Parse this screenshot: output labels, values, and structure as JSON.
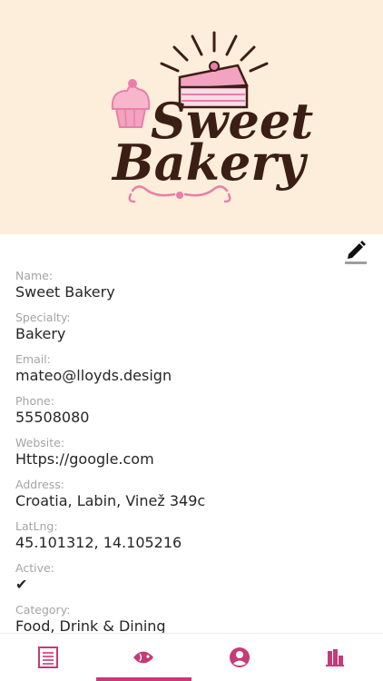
{
  "brand": {
    "logo_line1": "Sweet",
    "logo_line2": "Bakery",
    "hero_bg": "#fdeedb",
    "text_color": "#3b1e14",
    "accent_pink": "#e97fa8"
  },
  "toolbar": {
    "edit_icon": "pencil-edit-icon"
  },
  "fields": [
    {
      "label": "Name:",
      "value": "Sweet Bakery"
    },
    {
      "label": "Specialty:",
      "value": "Bakery"
    },
    {
      "label": "Email:",
      "value": "mateo@lloyds.design"
    },
    {
      "label": "Phone:",
      "value": "55508080"
    },
    {
      "label": "Website:",
      "value": "Https://google.com"
    },
    {
      "label": "Address:",
      "value": "Croatia, Labin, Vinež 349c"
    },
    {
      "label": "LatLng:",
      "value": "45.101312, 14.105216"
    },
    {
      "label": "Active:",
      "value": "✔"
    },
    {
      "label": "Category:",
      "value": "Food, Drink & Dining"
    }
  ],
  "bottom_nav": {
    "active_index": 1,
    "accent": "#c43b78",
    "items": [
      {
        "icon": "document-list-icon"
      },
      {
        "icon": "fish-icon"
      },
      {
        "icon": "user-circle-icon"
      },
      {
        "icon": "bar-chart-icon"
      }
    ]
  }
}
